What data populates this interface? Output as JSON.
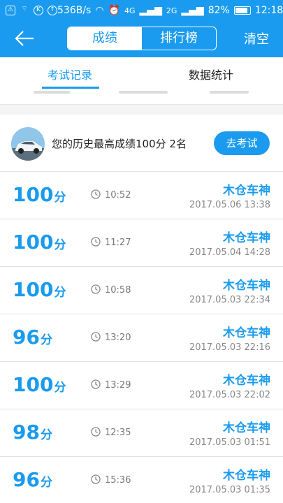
{
  "status_bar": {
    "speed": "536B/s",
    "network_4g": "4G",
    "network_2g": "2G",
    "battery": "82%",
    "time": "12:18"
  },
  "header": {
    "tab_score": "成绩",
    "tab_rank": "排行榜",
    "clear": "清空"
  },
  "tabs": {
    "records": "考试记录",
    "stats": "数据统计"
  },
  "best": {
    "text": "您的历史最高成绩100分  2名",
    "button": "去考试"
  },
  "records": [
    {
      "score": "100",
      "unit": "分",
      "duration": "10:52",
      "name": "木仓车神",
      "date": "2017.05.06  13:38"
    },
    {
      "score": "100",
      "unit": "分",
      "duration": "11:27",
      "name": "木仓车神",
      "date": "2017.05.04  14:28"
    },
    {
      "score": "100",
      "unit": "分",
      "duration": "10:58",
      "name": "木仓车神",
      "date": "2017.05.03  22:34"
    },
    {
      "score": "96",
      "unit": "分",
      "duration": "13:20",
      "name": "木仓车神",
      "date": "2017.05.03  22:16"
    },
    {
      "score": "100",
      "unit": "分",
      "duration": "13:29",
      "name": "木仓车神",
      "date": "2017.05.03  22:02"
    },
    {
      "score": "98",
      "unit": "分",
      "duration": "12:35",
      "name": "木仓车神",
      "date": "2017.05.03  01:51"
    },
    {
      "score": "96",
      "unit": "分",
      "duration": "15:36",
      "name": "木仓车神",
      "date": "2017.05.03  01:35"
    }
  ],
  "colors": {
    "accent": "#1a9bef"
  }
}
